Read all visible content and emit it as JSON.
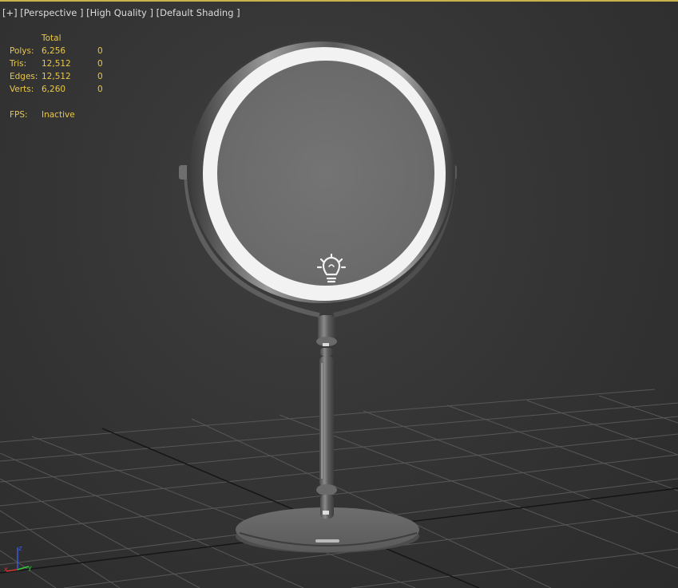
{
  "viewport": {
    "labels": [
      "[+]",
      "[Perspective ]",
      "[High Quality ]",
      "[Default Shading ]"
    ]
  },
  "stats": {
    "header": "Total",
    "rows": [
      {
        "label": "Polys:",
        "total": "6,256",
        "selected": "0"
      },
      {
        "label": "Tris:",
        "total": "12,512",
        "selected": "0"
      },
      {
        "label": "Edges:",
        "total": "12,512",
        "selected": "0"
      },
      {
        "label": "Verts:",
        "total": "6,260",
        "selected": "0"
      }
    ],
    "fps_label": "FPS:",
    "fps_value": "Inactive"
  },
  "axis_gizmo": {
    "labels": [
      "z",
      "x",
      "y"
    ]
  },
  "colors": {
    "frame_border": "#c8b24a",
    "stats_text": "#e8c84a",
    "grid_line": "#555555",
    "grid_axis": "#111111"
  }
}
